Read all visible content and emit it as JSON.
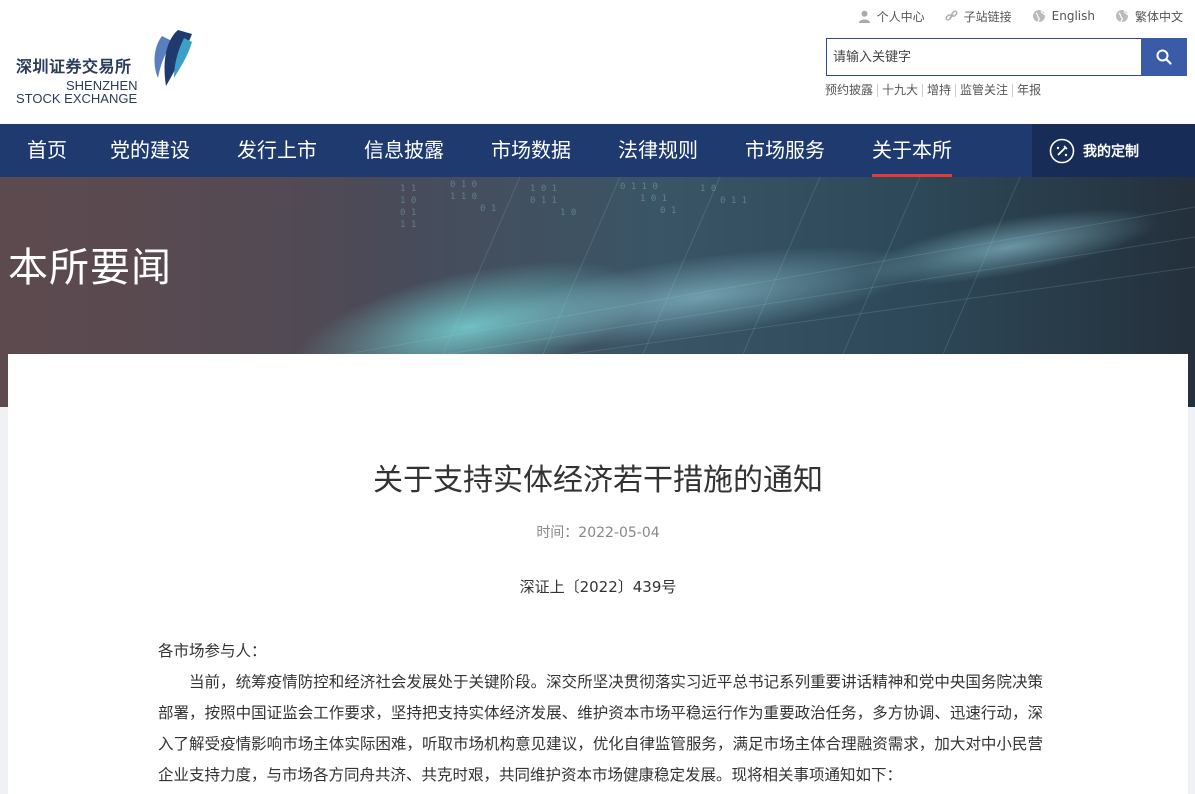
{
  "logo": {
    "cn": "深圳证券交易所",
    "en_line1": "SHENZHEN",
    "en_line2": "STOCK EXCHANGE"
  },
  "toplinks": [
    {
      "label": "个人中心",
      "icon": "user-icon"
    },
    {
      "label": "子站链接",
      "icon": "link-icon"
    },
    {
      "label": "English",
      "icon": "globe-icon"
    },
    {
      "label": "繁体中文",
      "icon": "globe-icon"
    }
  ],
  "search": {
    "placeholder": "请输入关键字"
  },
  "hotwords": [
    "预约披露",
    "十九大",
    "增持",
    "监管关注",
    "年报"
  ],
  "nav": {
    "items": [
      "首页",
      "党的建设",
      "发行上市",
      "信息披露",
      "市场数据",
      "法律规则",
      "市场服务",
      "关于本所"
    ],
    "active": "关于本所",
    "custom_label": "我的定制"
  },
  "banner": {
    "title": "本所要闻"
  },
  "article": {
    "title": "关于支持实体经济若干措施的通知",
    "date": "时间：2022-05-04",
    "doc_no": "深证上〔2022〕439号",
    "salutation": "各市场参与人：",
    "paragraph": "当前，统筹疫情防控和经济社会发展处于关键阶段。深交所坚决贯彻落实习近平总书记系列重要讲话精神和党中央国务院决策部署，按照中国证监会工作要求，坚持把支持实体经济发展、维护资本市场平稳运行作为重要政治任务，多方协调、迅速行动，深入了解受疫情影响市场主体实际困难，听取市场机构意见建议，优化自律监管服务，满足市场主体合理融资需求，加大对中小民营企业支持力度，与市场各方同舟共济、共克时艰，共同维护资本市场健康稳定发展。现将相关事项通知如下："
  },
  "colors": {
    "nav_bg": "#1e3a6e",
    "active_underline": "#e03a3a",
    "search_btn": "#3a5ba8"
  }
}
